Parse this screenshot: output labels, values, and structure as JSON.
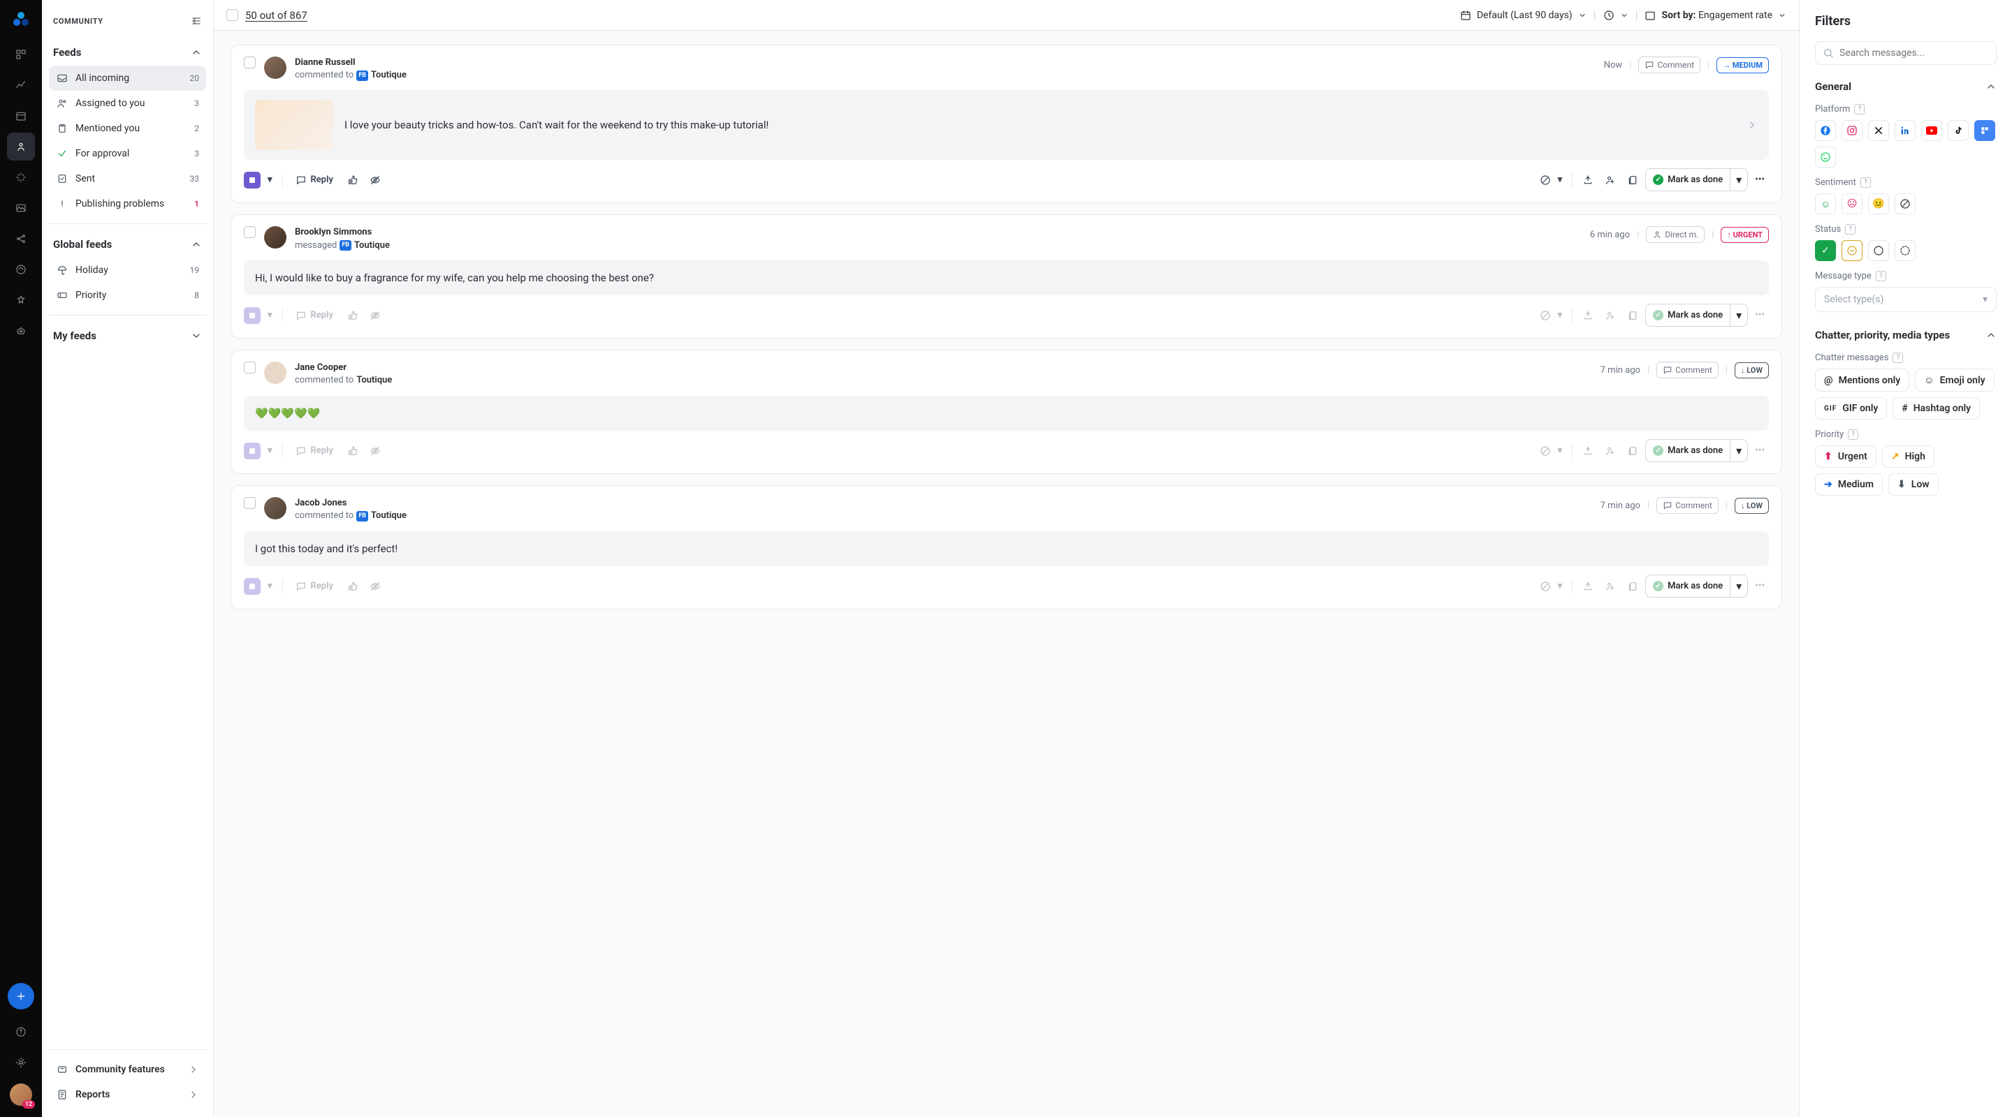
{
  "iconbar": {
    "avatar_badge": "12"
  },
  "sidebar": {
    "header": "COMMUNITY",
    "feeds_label": "Feeds",
    "items": [
      {
        "label": "All incoming",
        "count": "20"
      },
      {
        "label": "Assigned to you",
        "count": "3"
      },
      {
        "label": "Mentioned you",
        "count": "2"
      },
      {
        "label": "For approval",
        "count": "3"
      },
      {
        "label": "Sent",
        "count": "33"
      },
      {
        "label": "Publishing problems",
        "count": "1"
      }
    ],
    "global_label": "Global feeds",
    "global": [
      {
        "label": "Holiday",
        "count": "19"
      },
      {
        "label": "Priority",
        "count": "8"
      }
    ],
    "myfeeds_label": "My feeds",
    "footer": {
      "community": "Community features",
      "reports": "Reports"
    }
  },
  "topbar": {
    "count": "50 out of 867",
    "range": "Default (Last 90 days)",
    "sort_prefix": "Sort by:",
    "sort_value": "Engagement rate"
  },
  "cards": [
    {
      "name": "Dianne Russell",
      "action": "commented to",
      "page": "Toutique",
      "time": "Now",
      "comment_btn": "Comment",
      "priority": "MEDIUM",
      "body": "I love your beauty tricks and how-tos. Can't wait for the weekend to try this make-up tutorial!",
      "has_thumb": true,
      "has_chev": true,
      "pale": false,
      "direct": false
    },
    {
      "name": "Brooklyn Simmons",
      "action": "messaged",
      "page": "Toutique",
      "time": "6 min ago",
      "comment_btn": "",
      "priority": "URGENT",
      "body": "Hi, I would like to buy a fragrance for my wife, can you help me choosing the best one?",
      "has_thumb": false,
      "has_chev": false,
      "pale": true,
      "direct": true,
      "direct_label": "Direct m."
    },
    {
      "name": "Jane Cooper",
      "action": "commented to",
      "page": "Toutique",
      "time": "7 min ago",
      "comment_btn": "Comment",
      "priority": "LOW",
      "body": "💚💚💚💚💚",
      "has_thumb": false,
      "has_chev": false,
      "pale": true,
      "direct": false,
      "no_fb": true
    },
    {
      "name": "Jacob Jones",
      "action": "commented to",
      "page": "Toutique",
      "time": "7 min ago",
      "comment_btn": "Comment",
      "priority": "LOW",
      "body": "I got this today and it's perfect!",
      "has_thumb": false,
      "has_chev": false,
      "pale": true,
      "direct": false
    }
  ],
  "actions": {
    "reply": "Reply",
    "mark": "Mark as done"
  },
  "filters": {
    "title": "Filters",
    "search_placeholder": "Search messages...",
    "general": "General",
    "platform": "Platform",
    "sentiment": "Sentiment",
    "status": "Status",
    "msgtype": "Message type",
    "msgtype_placeholder": "Select type(s)",
    "chatter_sec": "Chatter, priority, media types",
    "chatter": "Chatter messages",
    "chatter_opts": [
      "Mentions only",
      "Emoji only",
      "GIF only",
      "Hashtag only"
    ],
    "priority": "Priority",
    "priority_opts": [
      "Urgent",
      "High",
      "Medium",
      "Low"
    ]
  }
}
